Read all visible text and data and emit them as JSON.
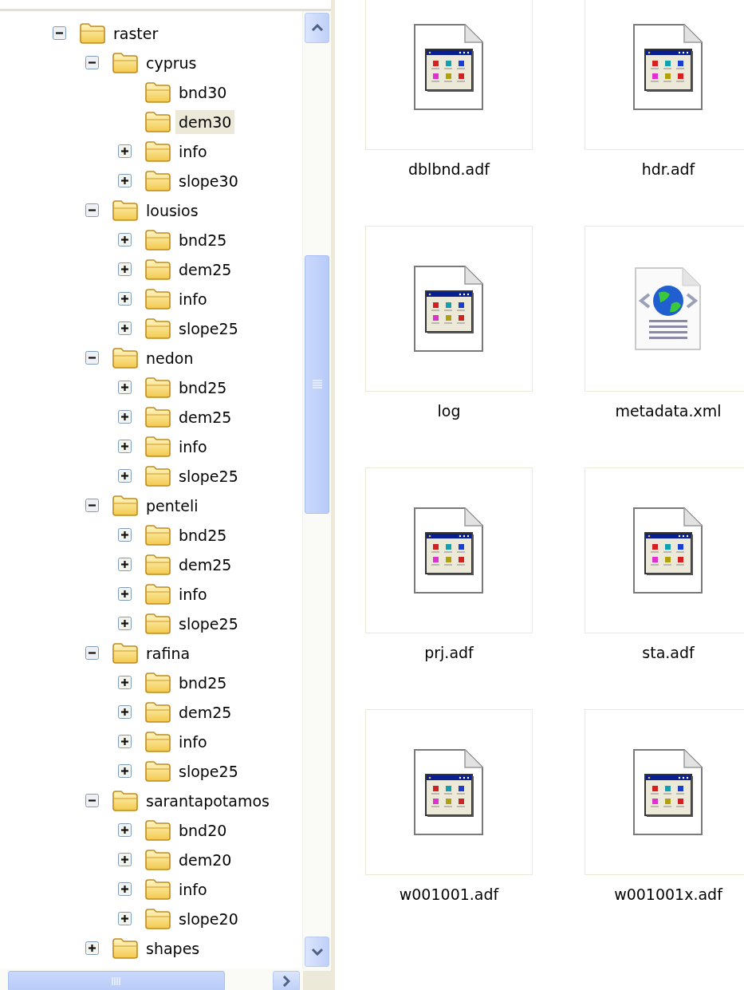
{
  "tree": [
    {
      "label": "raster",
      "kind": "folder",
      "expanded": true,
      "selected": false,
      "children": [
        {
          "label": "cyprus",
          "kind": "folder",
          "expanded": true,
          "selected": false,
          "children": [
            {
              "label": "bnd30",
              "kind": "leaf",
              "selected": false
            },
            {
              "label": "dem30",
              "kind": "leaf",
              "selected": true
            },
            {
              "label": "info",
              "kind": "folder",
              "expanded": false,
              "selected": false
            },
            {
              "label": "slope30",
              "kind": "folder",
              "expanded": false,
              "selected": false
            }
          ]
        },
        {
          "label": "lousios",
          "kind": "folder",
          "expanded": true,
          "selected": false,
          "children": [
            {
              "label": "bnd25",
              "kind": "folder",
              "expanded": false,
              "selected": false
            },
            {
              "label": "dem25",
              "kind": "folder",
              "expanded": false,
              "selected": false
            },
            {
              "label": "info",
              "kind": "folder",
              "expanded": false,
              "selected": false
            },
            {
              "label": "slope25",
              "kind": "folder",
              "expanded": false,
              "selected": false
            }
          ]
        },
        {
          "label": "nedon",
          "kind": "folder",
          "expanded": true,
          "selected": false,
          "children": [
            {
              "label": "bnd25",
              "kind": "folder",
              "expanded": false,
              "selected": false
            },
            {
              "label": "dem25",
              "kind": "folder",
              "expanded": false,
              "selected": false
            },
            {
              "label": "info",
              "kind": "folder",
              "expanded": false,
              "selected": false
            },
            {
              "label": "slope25",
              "kind": "folder",
              "expanded": false,
              "selected": false
            }
          ]
        },
        {
          "label": "penteli",
          "kind": "folder",
          "expanded": true,
          "selected": false,
          "children": [
            {
              "label": "bnd25",
              "kind": "folder",
              "expanded": false,
              "selected": false
            },
            {
              "label": "dem25",
              "kind": "folder",
              "expanded": false,
              "selected": false
            },
            {
              "label": "info",
              "kind": "folder",
              "expanded": false,
              "selected": false
            },
            {
              "label": "slope25",
              "kind": "folder",
              "expanded": false,
              "selected": false
            }
          ]
        },
        {
          "label": "rafina",
          "kind": "folder",
          "expanded": true,
          "selected": false,
          "children": [
            {
              "label": "bnd25",
              "kind": "folder",
              "expanded": false,
              "selected": false
            },
            {
              "label": "dem25",
              "kind": "folder",
              "expanded": false,
              "selected": false
            },
            {
              "label": "info",
              "kind": "folder",
              "expanded": false,
              "selected": false
            },
            {
              "label": "slope25",
              "kind": "folder",
              "expanded": false,
              "selected": false
            }
          ]
        },
        {
          "label": "sarantapotamos",
          "kind": "folder",
          "expanded": true,
          "selected": false,
          "children": [
            {
              "label": "bnd20",
              "kind": "folder",
              "expanded": false,
              "selected": false
            },
            {
              "label": "dem20",
              "kind": "folder",
              "expanded": false,
              "selected": false
            },
            {
              "label": "info",
              "kind": "folder",
              "expanded": false,
              "selected": false
            },
            {
              "label": "slope20",
              "kind": "folder",
              "expanded": false,
              "selected": false
            }
          ]
        },
        {
          "label": "shapes",
          "kind": "folder",
          "expanded": false,
          "selected": false
        }
      ]
    }
  ],
  "files": [
    {
      "name": "dblbnd.adf",
      "kind": "app-file"
    },
    {
      "name": "hdr.adf",
      "kind": "app-file"
    },
    {
      "name": "log",
      "kind": "app-file"
    },
    {
      "name": "metadata.xml",
      "kind": "xml-file"
    },
    {
      "name": "prj.adf",
      "kind": "app-file"
    },
    {
      "name": "sta.adf",
      "kind": "app-file"
    },
    {
      "name": "w001001.adf",
      "kind": "app-file"
    },
    {
      "name": "w001001x.adf",
      "kind": "app-file"
    }
  ]
}
